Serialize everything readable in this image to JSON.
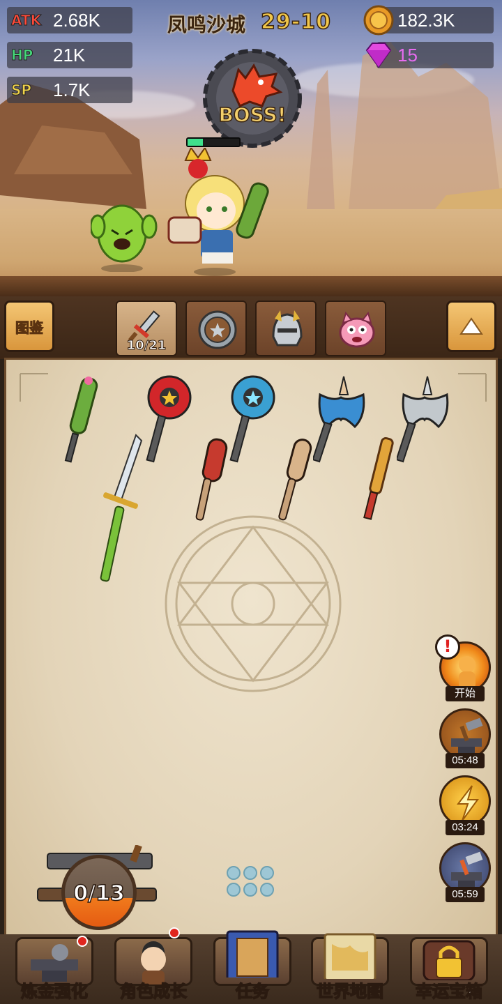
{
  "stats": {
    "atk": {
      "label": "ATK",
      "value": "2.68K",
      "color": "#ff4a3a"
    },
    "hp": {
      "label": "HP",
      "value": "21K",
      "color": "#45d97a"
    },
    "sp": {
      "label": "SP",
      "value": "1.7K",
      "color": "#f0d24a"
    }
  },
  "header": {
    "location": "凤鸣沙城",
    "stage": "29-10"
  },
  "currency": {
    "gold": {
      "value": "182.3K",
      "icon": "gold-coin-icon"
    },
    "gems": {
      "value": "15",
      "icon": "pink-gem-icon"
    }
  },
  "boss": {
    "label": "BOSS!",
    "hp_fraction": 0.3
  },
  "tabs": {
    "codex_label": "图鉴",
    "weapon_count": "10/21",
    "items": [
      "weapon-tab-icon",
      "shield-tab-icon",
      "helmet-tab-icon",
      "pet-tab-icon"
    ]
  },
  "side_buttons": [
    {
      "name": "fire-hero-event",
      "label": "开始",
      "icon": "fire-hero-icon",
      "alert": "!"
    },
    {
      "name": "anvil-boost-1",
      "label": "05:48",
      "icon": "anvil-hammer-icon"
    },
    {
      "name": "lightning-boost",
      "label": "03:24",
      "icon": "lightning-icon"
    },
    {
      "name": "anvil-boost-2",
      "label": "05:59",
      "icon": "anvil-hammer-icon"
    }
  ],
  "forge": {
    "progress_label": "0/13",
    "count": 0,
    "total": 13
  },
  "nav": [
    {
      "label": "炼金强化",
      "icon": "alchemy-anvil-icon",
      "badge": true
    },
    {
      "label": "角色成长",
      "icon": "hero-portrait-icon",
      "badge": true
    },
    {
      "label": "任务",
      "icon": "quest-book-icon",
      "badge": false
    },
    {
      "label": "世界地图",
      "icon": "world-map-icon",
      "badge": false
    },
    {
      "label": "幸运宝箱",
      "icon": "locked-chest-icon",
      "badge": false
    }
  ],
  "colors": {
    "accent_gold": "#f1c74a",
    "parchment": "#e3d4b8",
    "nav_bg": "#3a2a1d"
  }
}
